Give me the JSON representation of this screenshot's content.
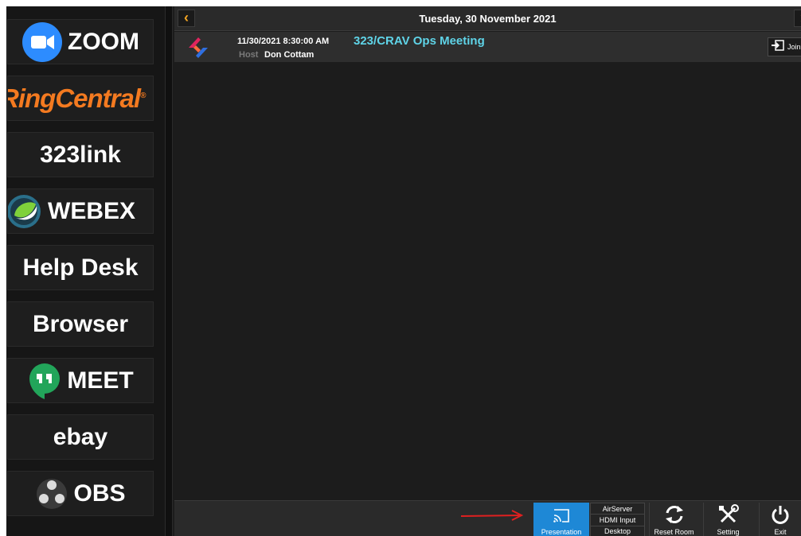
{
  "sidebar": {
    "apps": [
      {
        "id": "zoom",
        "label": "ZOOM",
        "icon": "zoom-camera-icon"
      },
      {
        "id": "ringcentral",
        "label": "RingCentral",
        "icon": "ringcentral-logo"
      },
      {
        "id": "323link",
        "label": "323link"
      },
      {
        "id": "webex",
        "label": "WEBEX",
        "icon": "webex-logo-icon"
      },
      {
        "id": "helpdesk",
        "label": "Help Desk"
      },
      {
        "id": "browser",
        "label": "Browser"
      },
      {
        "id": "meet",
        "label": "MEET",
        "icon": "hangouts-quote-icon"
      },
      {
        "id": "ebay",
        "label": "ebay"
      },
      {
        "id": "obs",
        "label": "OBS",
        "icon": "obs-logo-icon"
      }
    ]
  },
  "header": {
    "date": "Tuesday, 30 November 2021",
    "prev_icon": "chevron-left-icon",
    "next_icon": "chevron-right-icon"
  },
  "meeting": {
    "datetime": "11/30/2021 8:30:00 AM",
    "title": "323/CRAV Ops Meeting",
    "host_label": "Host",
    "host_name": "Don Cottam",
    "join_label": "Join",
    "join_icon": "join-meeting-icon"
  },
  "toolbar": {
    "presentation_label": "Presentation",
    "sources": [
      "AirServer",
      "HDMI Input",
      "Desktop"
    ],
    "reset_label": "Reset Room",
    "setting_label": "Setting",
    "exit_label": "Exit"
  },
  "colors": {
    "accent_blue": "#1e88d6",
    "meeting_title": "#5fd4e8",
    "nav_arrow": "#f5a623",
    "annotation_arrow": "#e02020",
    "ringcentral_orange": "#f47a20",
    "zoom_blue": "#2d8cff",
    "meet_green": "#22a55a"
  }
}
